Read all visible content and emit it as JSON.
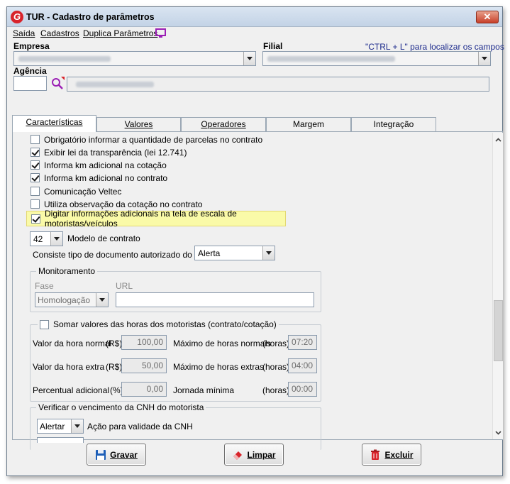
{
  "window": {
    "title": "TUR - Cadastro de parâmetros",
    "close_label": "✕"
  },
  "menu": [
    "Saída",
    "Cadastros",
    "Duplica Parâmetros"
  ],
  "header": {
    "empresa_label": "Empresa",
    "filial_label": "Filial",
    "hint": "\"CTRL + L\" para localizar os campos",
    "agencia_label": "Agência"
  },
  "tabs": [
    "Características",
    "Valores",
    "Operadores",
    "Margem",
    "Integração"
  ],
  "checkboxes": [
    {
      "label": "Obrigatório informar a quantidade de parcelas no contrato",
      "checked": false
    },
    {
      "label": "Exibir lei da transparência (lei 12.741)",
      "checked": true
    },
    {
      "label": "Informa km adicional na cotação",
      "checked": true
    },
    {
      "label": "Informa km adicional no contrato",
      "checked": true
    },
    {
      "label": "Comunicação Veltec",
      "checked": false
    },
    {
      "label": "Utiliza observação da cotação no contrato",
      "checked": false
    },
    {
      "label": "Digitar informações adicionais na tela de escala de motoristas/veículos",
      "checked": true
    }
  ],
  "modelo": {
    "value": "42",
    "label": "Modelo de contrato"
  },
  "dvs": {
    "label": "Consiste tipo de documento autorizado do DVS",
    "value": "Alerta"
  },
  "monitoramento": {
    "title": "Monitoramento",
    "fase_label": "Fase",
    "fase_value": "Homologação",
    "url_label": "URL",
    "url_value": ""
  },
  "horas": {
    "title": "Somar valores das horas dos motoristas (contrato/cotação)",
    "rows": [
      {
        "label": "Valor da hora normal",
        "unit": "(R$)",
        "value": "100,00",
        "label2": "Máximo de horas normais",
        "unit2": "(horas)",
        "value2": "07:20"
      },
      {
        "label": "Valor da hora extra",
        "unit": "(R$)",
        "value": "50,00",
        "label2": "Máximo de horas extras",
        "unit2": "(horas)",
        "value2": "04:00"
      },
      {
        "label": "Percentual adicional",
        "unit": "(%)",
        "value": "0,00",
        "label2": "Jornada mínima",
        "unit2": "(horas)",
        "value2": "00:00"
      }
    ]
  },
  "cnh": {
    "title": "Verificar o vencimento da CNH do motorista",
    "value": "Alertar",
    "label": "Ação para validade da CNH"
  },
  "buttons": {
    "save": "Gravar",
    "clear": "Limpar",
    "delete": "Excluir"
  }
}
